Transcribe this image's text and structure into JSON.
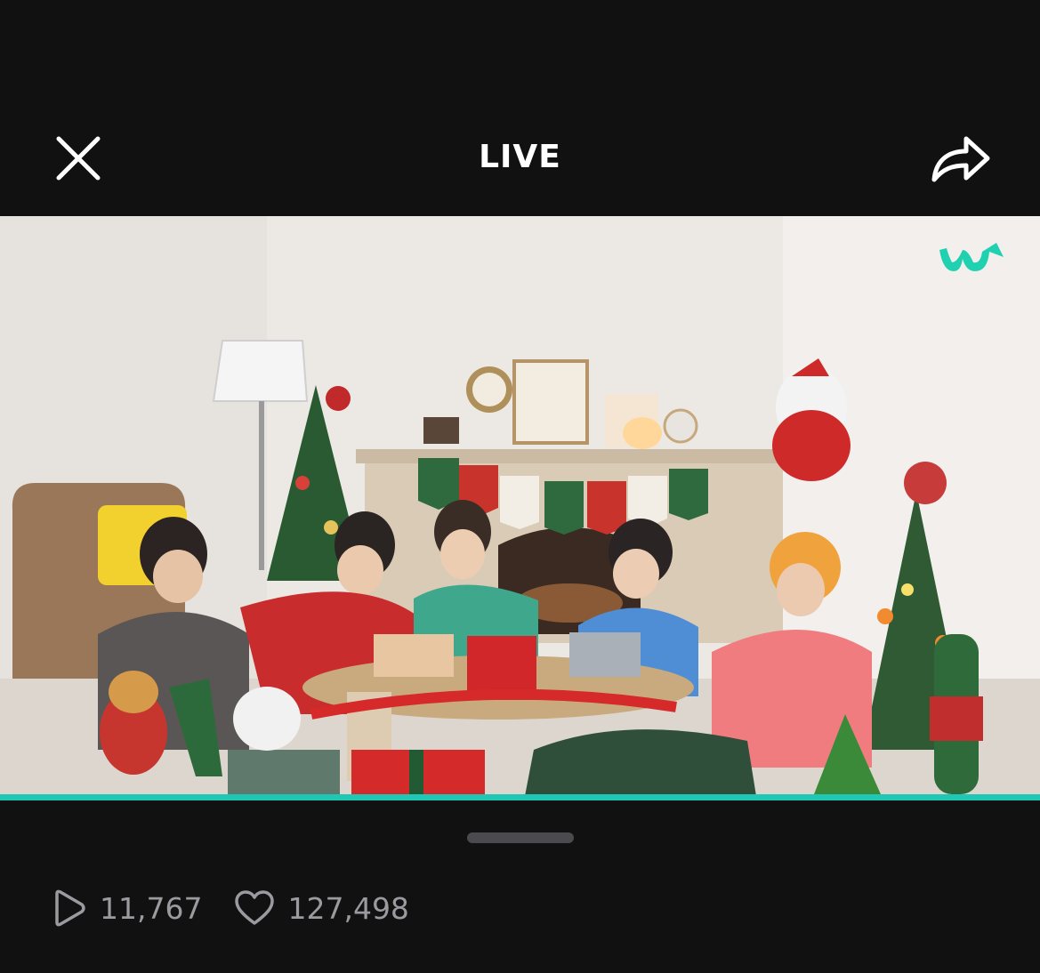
{
  "header": {
    "title": "LIVE",
    "close_icon": "close-icon",
    "share_icon": "share-icon"
  },
  "video": {
    "brand_logo": "weverse-logo",
    "brand_color": "#1fd1b0",
    "scene_description_icon": "video-frame"
  },
  "player": {
    "progress_fraction": 1.0,
    "progress_color": "#1fc8b4"
  },
  "stats": {
    "plays_icon": "play-icon",
    "plays": "11,767",
    "likes_icon": "heart-icon",
    "likes": "127,498"
  }
}
